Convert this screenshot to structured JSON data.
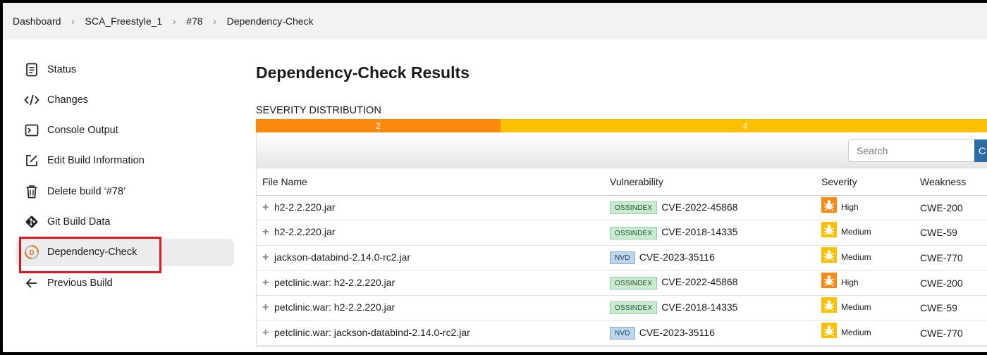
{
  "breadcrumb": {
    "items": [
      "Dashboard",
      "SCA_Freestyle_1",
      "#78",
      "Dependency-Check"
    ]
  },
  "sidebar": {
    "items": [
      {
        "label": "Status",
        "icon": "document-icon"
      },
      {
        "label": "Changes",
        "icon": "code-icon"
      },
      {
        "label": "Console Output",
        "icon": "terminal-icon"
      },
      {
        "label": "Edit Build Information",
        "icon": "edit-icon"
      },
      {
        "label": "Delete build ‘#78’",
        "icon": "trash-icon"
      },
      {
        "label": "Git Build Data",
        "icon": "git-icon"
      },
      {
        "label": "Dependency-Check",
        "icon": "dependency-check-icon",
        "active": true
      },
      {
        "label": "Previous Build",
        "icon": "arrow-left-icon"
      }
    ]
  },
  "main": {
    "title": "Dependency-Check Results",
    "severity_label": "SEVERITY DISTRIBUTION",
    "severity_distribution": [
      {
        "label": "2",
        "count": 2,
        "color": "#f98a0f"
      },
      {
        "label": "4",
        "count": 4,
        "color": "#fdc000"
      }
    ],
    "search_placeholder": "Search",
    "search_button": "C",
    "table": {
      "columns": [
        "File Name",
        "Vulnerability",
        "Severity",
        "Weakness"
      ],
      "rows": [
        {
          "file": "h2-2.2.220.jar",
          "source": "OSSINDEX",
          "cve": "CVE-2022-45868",
          "severity": "High",
          "weakness": "CWE-200"
        },
        {
          "file": "h2-2.2.220.jar",
          "source": "OSSINDEX",
          "cve": "CVE-2018-14335",
          "severity": "Medium",
          "weakness": "CWE-59"
        },
        {
          "file": "jackson-databind-2.14.0-rc2.jar",
          "source": "NVD",
          "cve": "CVE-2023-35116",
          "severity": "Medium",
          "weakness": "CWE-770"
        },
        {
          "file": "petclinic.war: h2-2.2.220.jar",
          "source": "OSSINDEX",
          "cve": "CVE-2022-45868",
          "severity": "High",
          "weakness": "CWE-200"
        },
        {
          "file": "petclinic.war: h2-2.2.220.jar",
          "source": "OSSINDEX",
          "cve": "CVE-2018-14335",
          "severity": "Medium",
          "weakness": "CWE-59"
        },
        {
          "file": "petclinic.war: jackson-databind-2.14.0-rc2.jar",
          "source": "NVD",
          "cve": "CVE-2023-35116",
          "severity": "Medium",
          "weakness": "CWE-770"
        }
      ]
    }
  },
  "colors": {
    "high": "#f98a0f",
    "medium": "#fdc000",
    "highlight": "#e3161f",
    "search_button": "#2e6da4"
  }
}
